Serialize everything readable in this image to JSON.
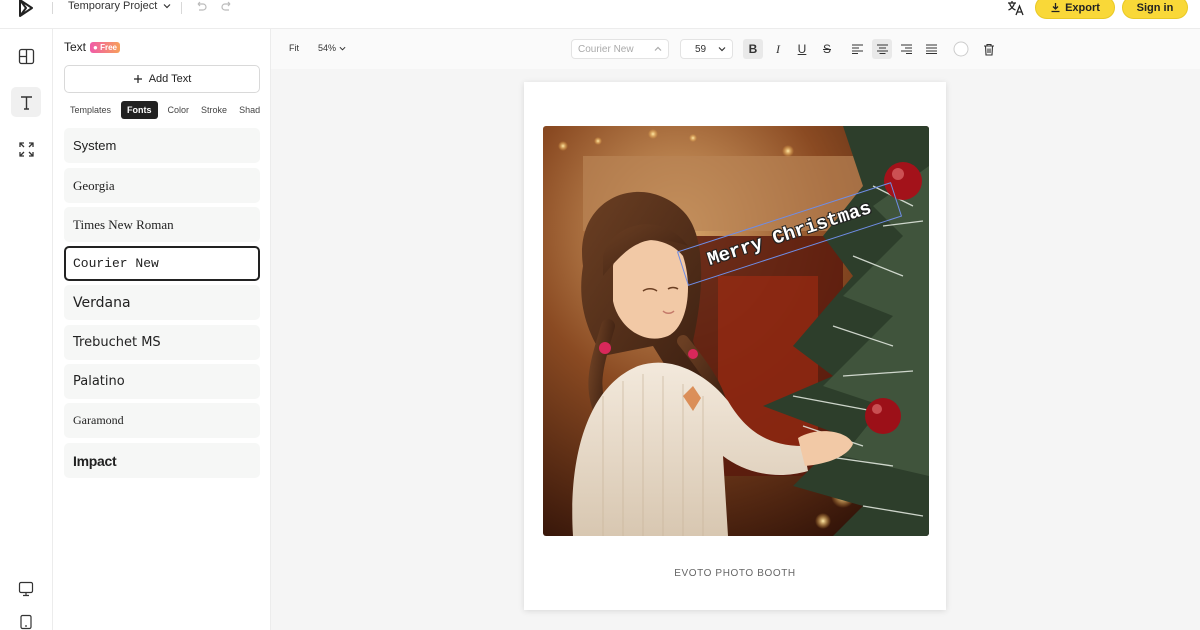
{
  "header": {
    "project_name": "Temporary Project",
    "export_label": "Export",
    "signin_label": "Sign in"
  },
  "panel": {
    "title": "Text",
    "badge": "Free",
    "add_text_label": "Add Text",
    "tabs": [
      "Templates",
      "Fonts",
      "Color",
      "Stroke",
      "Shad"
    ],
    "active_tab": "Fonts",
    "fonts": [
      {
        "label": "System"
      },
      {
        "label": "Georgia"
      },
      {
        "label": "Times New Roman"
      },
      {
        "label": "Courier New"
      },
      {
        "label": "Verdana"
      },
      {
        "label": "Trebuchet MS"
      },
      {
        "label": "Palatino"
      },
      {
        "label": "Garamond"
      },
      {
        "label": "Impact"
      }
    ],
    "selected_font": "Courier New"
  },
  "toolbar": {
    "fit_label": "Fit",
    "zoom_label": "54%",
    "font_family": "Courier New",
    "font_size": "59"
  },
  "canvas": {
    "overlay_text": "Merry Christmas",
    "caption": "EVOTO PHOTO BOOTH"
  },
  "icons": {
    "rail": [
      "layout-icon",
      "text-icon",
      "resize-icon",
      "feedback-icon",
      "device-icon"
    ],
    "toolbar": [
      "bold-icon",
      "italic-icon",
      "underline-icon",
      "strikethrough-icon",
      "align-left-icon",
      "align-center-icon",
      "align-right-icon",
      "align-justify-icon",
      "color-swatch-icon",
      "delete-icon"
    ]
  },
  "colors": {
    "accent": "#f9d838",
    "selection_outline": "#6f8de6",
    "badge_gradient_start": "#f05aa8",
    "badge_gradient_end": "#f7a05a"
  }
}
